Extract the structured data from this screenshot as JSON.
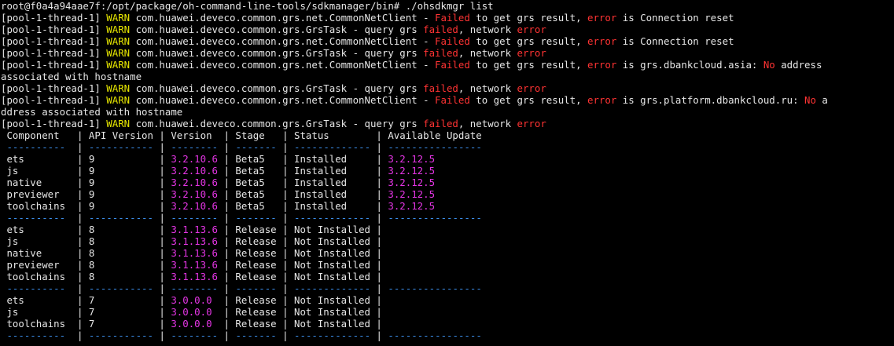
{
  "lines": [
    [
      {
        "t": "root@f0a4a94aae7f:/opt/package/oh-command-line-tools/sdkmanager/bin# ./ohsdkmgr list",
        "c": "w"
      }
    ],
    [
      {
        "t": "[pool-1-thread-1] ",
        "c": "w"
      },
      {
        "t": "WARN",
        "c": "y"
      },
      {
        "t": " com.huawei.deveco.common.grs.net.CommonNetClient - ",
        "c": "w"
      },
      {
        "t": "Failed",
        "c": "r"
      },
      {
        "t": " to get grs result, ",
        "c": "w"
      },
      {
        "t": "error",
        "c": "r"
      },
      {
        "t": " is Connection reset",
        "c": "w"
      }
    ],
    [
      {
        "t": "[pool-1-thread-1] ",
        "c": "w"
      },
      {
        "t": "WARN",
        "c": "y"
      },
      {
        "t": " com.huawei.deveco.common.grs.GrsTask - query grs ",
        "c": "w"
      },
      {
        "t": "failed",
        "c": "r"
      },
      {
        "t": ", network ",
        "c": "w"
      },
      {
        "t": "error",
        "c": "r"
      }
    ],
    [
      {
        "t": "[pool-1-thread-1] ",
        "c": "w"
      },
      {
        "t": "WARN",
        "c": "y"
      },
      {
        "t": " com.huawei.deveco.common.grs.net.CommonNetClient - ",
        "c": "w"
      },
      {
        "t": "Failed",
        "c": "r"
      },
      {
        "t": " to get grs result, ",
        "c": "w"
      },
      {
        "t": "error",
        "c": "r"
      },
      {
        "t": " is Connection reset",
        "c": "w"
      }
    ],
    [
      {
        "t": "[pool-1-thread-1] ",
        "c": "w"
      },
      {
        "t": "WARN",
        "c": "y"
      },
      {
        "t": " com.huawei.deveco.common.grs.GrsTask - query grs ",
        "c": "w"
      },
      {
        "t": "failed",
        "c": "r"
      },
      {
        "t": ", network ",
        "c": "w"
      },
      {
        "t": "error",
        "c": "r"
      }
    ],
    [
      {
        "t": "[pool-1-thread-1] ",
        "c": "w"
      },
      {
        "t": "WARN",
        "c": "y"
      },
      {
        "t": " com.huawei.deveco.common.grs.net.CommonNetClient - ",
        "c": "w"
      },
      {
        "t": "Failed",
        "c": "r"
      },
      {
        "t": " to get grs result, ",
        "c": "w"
      },
      {
        "t": "error",
        "c": "r"
      },
      {
        "t": " is grs.dbankcloud.asia: ",
        "c": "w"
      },
      {
        "t": "No",
        "c": "r"
      },
      {
        "t": " address",
        "c": "w"
      }
    ],
    [
      {
        "t": "associated with hostname",
        "c": "w"
      }
    ],
    [
      {
        "t": "[pool-1-thread-1] ",
        "c": "w"
      },
      {
        "t": "WARN",
        "c": "y"
      },
      {
        "t": " com.huawei.deveco.common.grs.GrsTask - query grs ",
        "c": "w"
      },
      {
        "t": "failed",
        "c": "r"
      },
      {
        "t": ", network ",
        "c": "w"
      },
      {
        "t": "error",
        "c": "r"
      }
    ],
    [
      {
        "t": "[pool-1-thread-1] ",
        "c": "w"
      },
      {
        "t": "WARN",
        "c": "y"
      },
      {
        "t": " com.huawei.deveco.common.grs.net.CommonNetClient - ",
        "c": "w"
      },
      {
        "t": "Failed",
        "c": "r"
      },
      {
        "t": " to get grs result, ",
        "c": "w"
      },
      {
        "t": "error",
        "c": "r"
      },
      {
        "t": " is grs.platform.dbankcloud.ru: ",
        "c": "w"
      },
      {
        "t": "No",
        "c": "r"
      },
      {
        "t": " a",
        "c": "w"
      }
    ],
    [
      {
        "t": "ddress associated with hostname",
        "c": "w"
      }
    ],
    [
      {
        "t": "[pool-1-thread-1] ",
        "c": "w"
      },
      {
        "t": "WARN",
        "c": "y"
      },
      {
        "t": " com.huawei.deveco.common.grs.GrsTask - query grs ",
        "c": "w"
      },
      {
        "t": "failed",
        "c": "r"
      },
      {
        "t": ", network ",
        "c": "w"
      },
      {
        "t": "error",
        "c": "r"
      }
    ],
    [
      {
        "t": " Component   | API Version | Version  | Stage   | Status        | Available Update",
        "c": "w"
      }
    ],
    [
      {
        "t": " ----------  ",
        "c": "b"
      },
      {
        "t": "|",
        "c": "w"
      },
      {
        "t": " ----------- ",
        "c": "b"
      },
      {
        "t": "|",
        "c": "w"
      },
      {
        "t": " -------- ",
        "c": "b"
      },
      {
        "t": "|",
        "c": "w"
      },
      {
        "t": " ------- ",
        "c": "b"
      },
      {
        "t": "|",
        "c": "w"
      },
      {
        "t": " ------------- ",
        "c": "b"
      },
      {
        "t": "|",
        "c": "w"
      },
      {
        "t": " ----------------",
        "c": "b"
      }
    ],
    [
      {
        "t": " ets         | 9           | ",
        "c": "w"
      },
      {
        "t": "3.2.10.6",
        "c": "m"
      },
      {
        "t": " | Beta5   | Installed     | ",
        "c": "w"
      },
      {
        "t": "3.2.12.5",
        "c": "m"
      }
    ],
    [
      {
        "t": " js          | 9           | ",
        "c": "w"
      },
      {
        "t": "3.2.10.6",
        "c": "m"
      },
      {
        "t": " | Beta5   | Installed     | ",
        "c": "w"
      },
      {
        "t": "3.2.12.5",
        "c": "m"
      }
    ],
    [
      {
        "t": " native      | 9           | ",
        "c": "w"
      },
      {
        "t": "3.2.10.6",
        "c": "m"
      },
      {
        "t": " | Beta5   | Installed     | ",
        "c": "w"
      },
      {
        "t": "3.2.12.5",
        "c": "m"
      }
    ],
    [
      {
        "t": " previewer   | 9           | ",
        "c": "w"
      },
      {
        "t": "3.2.10.6",
        "c": "m"
      },
      {
        "t": " | Beta5   | Installed     | ",
        "c": "w"
      },
      {
        "t": "3.2.12.5",
        "c": "m"
      }
    ],
    [
      {
        "t": " toolchains  | 9           | ",
        "c": "w"
      },
      {
        "t": "3.2.10.6",
        "c": "m"
      },
      {
        "t": " | Beta5   | Installed     | ",
        "c": "w"
      },
      {
        "t": "3.2.12.5",
        "c": "m"
      }
    ],
    [
      {
        "t": " ----------  ",
        "c": "b"
      },
      {
        "t": "|",
        "c": "w"
      },
      {
        "t": " ----------- ",
        "c": "b"
      },
      {
        "t": "|",
        "c": "w"
      },
      {
        "t": " -------- ",
        "c": "b"
      },
      {
        "t": "|",
        "c": "w"
      },
      {
        "t": " ------- ",
        "c": "b"
      },
      {
        "t": "|",
        "c": "w"
      },
      {
        "t": " ------------- ",
        "c": "b"
      },
      {
        "t": "|",
        "c": "w"
      },
      {
        "t": " ----------------",
        "c": "b"
      }
    ],
    [
      {
        "t": " ets         | 8           | ",
        "c": "w"
      },
      {
        "t": "3.1.13.6",
        "c": "m"
      },
      {
        "t": " | Release | Not Installed |",
        "c": "w"
      }
    ],
    [
      {
        "t": " js          | 8           | ",
        "c": "w"
      },
      {
        "t": "3.1.13.6",
        "c": "m"
      },
      {
        "t": " | Release | Not Installed |",
        "c": "w"
      }
    ],
    [
      {
        "t": " native      | 8           | ",
        "c": "w"
      },
      {
        "t": "3.1.13.6",
        "c": "m"
      },
      {
        "t": " | Release | Not Installed |",
        "c": "w"
      }
    ],
    [
      {
        "t": " previewer   | 8           | ",
        "c": "w"
      },
      {
        "t": "3.1.13.6",
        "c": "m"
      },
      {
        "t": " | Release | Not Installed |",
        "c": "w"
      }
    ],
    [
      {
        "t": " toolchains  | 8           | ",
        "c": "w"
      },
      {
        "t": "3.1.13.6",
        "c": "m"
      },
      {
        "t": " | Release | Not Installed |",
        "c": "w"
      }
    ],
    [
      {
        "t": " ----------  ",
        "c": "b"
      },
      {
        "t": "|",
        "c": "w"
      },
      {
        "t": " ----------- ",
        "c": "b"
      },
      {
        "t": "|",
        "c": "w"
      },
      {
        "t": " -------- ",
        "c": "b"
      },
      {
        "t": "|",
        "c": "w"
      },
      {
        "t": " ------- ",
        "c": "b"
      },
      {
        "t": "|",
        "c": "w"
      },
      {
        "t": " ------------- ",
        "c": "b"
      },
      {
        "t": "|",
        "c": "w"
      },
      {
        "t": " ----------------",
        "c": "b"
      }
    ],
    [
      {
        "t": " ets         | 7           | ",
        "c": "w"
      },
      {
        "t": "3.0.0.0",
        "c": "m"
      },
      {
        "t": "  | Release | Not Installed |",
        "c": "w"
      }
    ],
    [
      {
        "t": " js          | 7           | ",
        "c": "w"
      },
      {
        "t": "3.0.0.0",
        "c": "m"
      },
      {
        "t": "  | Release | Not Installed |",
        "c": "w"
      }
    ],
    [
      {
        "t": " toolchains  | 7           | ",
        "c": "w"
      },
      {
        "t": "3.0.0.0",
        "c": "m"
      },
      {
        "t": "  | Release | Not Installed |",
        "c": "w"
      }
    ],
    [
      {
        "t": " ----------  ",
        "c": "b"
      },
      {
        "t": "|",
        "c": "w"
      },
      {
        "t": " ----------- ",
        "c": "b"
      },
      {
        "t": "|",
        "c": "w"
      },
      {
        "t": " -------- ",
        "c": "b"
      },
      {
        "t": "|",
        "c": "w"
      },
      {
        "t": " ------- ",
        "c": "b"
      },
      {
        "t": "|",
        "c": "w"
      },
      {
        "t": " ------------- ",
        "c": "b"
      },
      {
        "t": "|",
        "c": "w"
      },
      {
        "t": " ----------------",
        "c": "b"
      }
    ]
  ]
}
